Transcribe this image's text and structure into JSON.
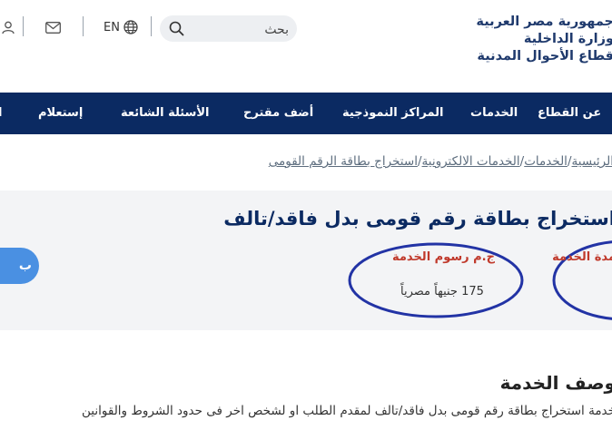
{
  "header": {
    "logo_lines": [
      "جمهورية مصر العربية",
      "وزارة الداخلية",
      "قطاع الأحوال المدنية"
    ],
    "search_placeholder": "بحث",
    "lang_label": "EN",
    "icons": [
      "user-icon",
      "mail-icon",
      "globe-icon",
      "search-icon"
    ]
  },
  "nav": {
    "items": [
      "عن القطاع",
      "الخدمات",
      "المراكز النموذجية",
      "أضف مقترح",
      "الأسئلة الشائعة",
      "إستعلام"
    ],
    "edge_fragment": "ا"
  },
  "breadcrumb": {
    "items": [
      "الرئيسية",
      "الخدمات",
      "الخدمات الالكترونية",
      "استخراج بطاقة الرقم القومى"
    ],
    "separator": "/"
  },
  "service": {
    "title": "استخراج بطاقة رقم قومى بدل فاقد/تالف",
    "fee_label": "ج.م رسوم الخدمة",
    "fee_value": "175 جنيهاً مصرياً",
    "right_label": "مدة الخدمة",
    "button_label": "ب",
    "annotation_color": "#2233a5"
  },
  "description": {
    "title": "وصف الخدمة",
    "text": "خدمة استخراج بطاقة رقم قومى بدل فاقد/تالف لمقدم الطلب او لشخص اخر فى حدود الشروط والقوانين"
  }
}
